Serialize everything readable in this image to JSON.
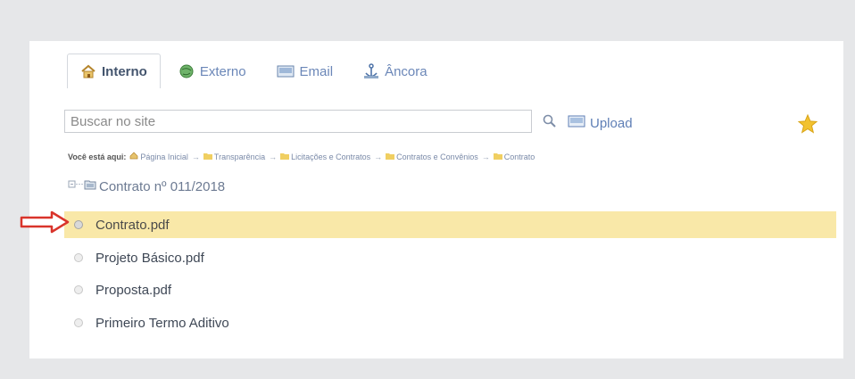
{
  "tabs": [
    {
      "label": "Interno",
      "icon": "home-icon",
      "active": true
    },
    {
      "label": "Externo",
      "icon": "globe-icon",
      "active": false
    },
    {
      "label": "Email",
      "icon": "email-icon",
      "active": false
    },
    {
      "label": "Âncora",
      "icon": "anchor-icon",
      "active": false
    }
  ],
  "search": {
    "placeholder": "Buscar no site"
  },
  "upload": {
    "label": "Upload"
  },
  "breadcrumb": {
    "lead": "Você está aqui:",
    "items": [
      "Página Inicial",
      "Transparência",
      "Licitações e Contratos",
      "Contratos e Convênios",
      "Contrato"
    ],
    "separator": "→"
  },
  "tree": {
    "title": "Contrato nº 011/2018"
  },
  "files": [
    {
      "label": "Contrato.pdf",
      "selected": true
    },
    {
      "label": "Projeto Básico.pdf",
      "selected": false
    },
    {
      "label": "Proposta.pdf",
      "selected": false
    },
    {
      "label": "Primeiro Termo Aditivo",
      "selected": false
    }
  ],
  "colors": {
    "highlight": "#f9e8a8",
    "arrow": "#d9342b",
    "link": "#5f7fb6",
    "star": "#f2c230"
  }
}
